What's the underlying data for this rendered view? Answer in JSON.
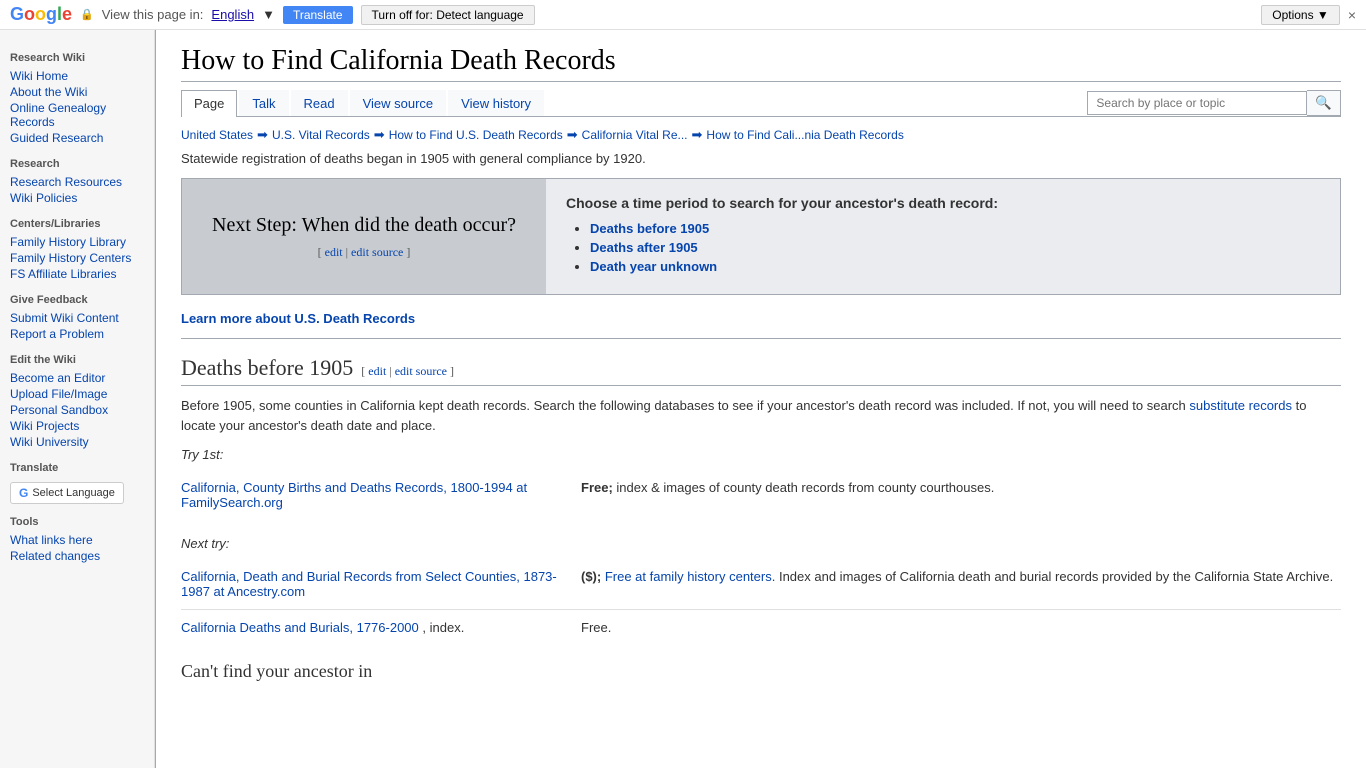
{
  "translate_bar": {
    "view_text": "View this page in:",
    "language": "English",
    "translate_btn": "Translate",
    "turnoff_btn": "Turn off for: Detect language",
    "options_btn": "Options ▼",
    "close_btn": "×"
  },
  "sidebar": {
    "top_title": "Research Wiki",
    "links_top": [
      {
        "label": "Wiki Home"
      },
      {
        "label": "About the Wiki"
      },
      {
        "label": "Online Genealogy Records"
      },
      {
        "label": "Guided Research"
      }
    ],
    "research_title": "Research",
    "research_links": [
      {
        "label": "Research Resources"
      },
      {
        "label": "Wiki Policies"
      }
    ],
    "centers_title": "Centers/Libraries",
    "centers_links": [
      {
        "label": "Family History Library"
      },
      {
        "label": "Family History Centers"
      },
      {
        "label": "FS Affiliate Libraries"
      }
    ],
    "feedback_title": "Give Feedback",
    "feedback_links": [
      {
        "label": "Submit Wiki Content"
      },
      {
        "label": "Report a Problem"
      }
    ],
    "edit_title": "Edit the Wiki",
    "edit_links": [
      {
        "label": "Become an Editor"
      },
      {
        "label": "Upload File/Image"
      },
      {
        "label": "Personal Sandbox"
      },
      {
        "label": "Wiki Projects"
      },
      {
        "label": "Wiki University"
      }
    ],
    "translate_title": "Translate",
    "select_language_btn": "Select Language",
    "tools_title": "Tools",
    "tools_links": [
      {
        "label": "What links here"
      },
      {
        "label": "Related changes"
      }
    ]
  },
  "page": {
    "title": "How to Find California Death Records",
    "tabs": [
      {
        "label": "Page",
        "active": true
      },
      {
        "label": "Talk",
        "active": false
      },
      {
        "label": "Read",
        "active": false
      },
      {
        "label": "View source",
        "active": false
      },
      {
        "label": "View history",
        "active": false
      }
    ],
    "search_placeholder": "Search by place or topic",
    "breadcrumb": [
      {
        "label": "United States"
      },
      {
        "label": "U.S. Vital Records"
      },
      {
        "label": "How to Find U.S. Death Records"
      },
      {
        "label": "California Vital Re..."
      },
      {
        "label": "How to Find Cali...nia Death Records"
      }
    ],
    "intro": "Statewide registration of deaths began in 1905 with general compliance by 1920.",
    "infobox": {
      "left_text": "Next Step: When did the death occur?",
      "edit_label": "[ edit | edit source ]",
      "right_title": "Choose a time period to search for your ancestor's death record:",
      "options": [
        {
          "label": "Deaths before 1905"
        },
        {
          "label": "Deaths after 1905"
        },
        {
          "label": "Death year unknown"
        }
      ]
    },
    "learn_more": "Learn more about U.S. Death Records",
    "section1": {
      "heading": "Deaths before 1905",
      "edit_links": "[ edit | edit source ]",
      "body": "Before 1905, some counties in California kept death records. Search the following databases to see if your ancestor's death record was included. If not, you will need to search substitute records to locate your ancestor's death date and place.",
      "substitute_link": "substitute records",
      "try1_label": "Try 1st:",
      "record1": {
        "link_text": "California, County Births and Deaths Records, 1800-1994 at FamilySearch.org",
        "description": "Free; index & images of county death records from county courthouses."
      },
      "try2_label": "Next try:",
      "record2": {
        "link_text": "California, Death and Burial Records from Select Counties, 1873-1987 at Ancestry.com",
        "description_prefix": "($);",
        "free_link": "Free at family history centers.",
        "description_suffix": "Index and images of California death and burial records provided by the California State Archive."
      },
      "record3": {
        "link_text": "California Deaths and Burials, 1776-2000",
        "description": ", index.",
        "free_label": "Free."
      }
    },
    "cant_find": "Can't find your ancestor in"
  }
}
